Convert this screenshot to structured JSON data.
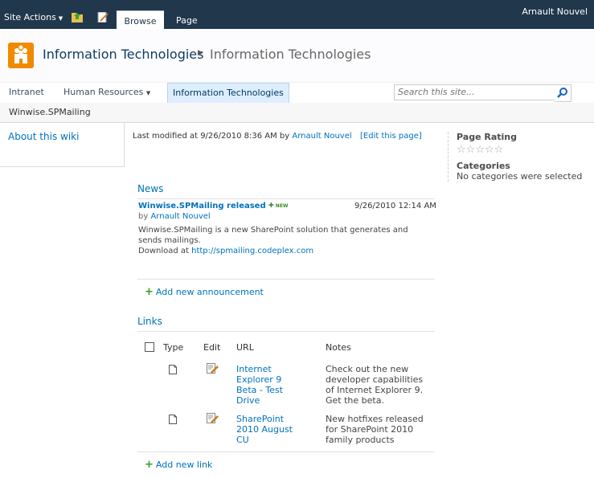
{
  "ribbon": {
    "site_actions_label": "Site Actions",
    "tabs": [
      {
        "label": "Browse",
        "selected": true
      },
      {
        "label": "Page",
        "selected": false
      }
    ],
    "user_name": "Arnault Nouvel"
  },
  "title_area": {
    "site_title": "Information Technologies",
    "page_title": "Information Technologies"
  },
  "top_nav": {
    "items": [
      {
        "label": "Intranet",
        "dropdown": false,
        "selected": false
      },
      {
        "label": "Human Resources",
        "dropdown": true,
        "selected": false
      },
      {
        "label": "Information Technologies",
        "dropdown": false,
        "selected": true
      }
    ],
    "search_placeholder": "Search this site..."
  },
  "breadcrumb": {
    "current": "Winwise.SPMailing"
  },
  "left_nav": {
    "link": "About this wiki"
  },
  "page_info": {
    "last_modified_prefix": "Last modified at 9/26/2010 8:36 AM by",
    "author": "Arnault Nouvel",
    "edit_label": "[Edit this page]"
  },
  "news": {
    "title": "News",
    "item": {
      "title": "Winwise.SPMailing released",
      "badge": "NEW",
      "date": "9/26/2010 12:14 AM",
      "by_prefix": "by",
      "author": "Arnault Nouvel",
      "body_line1": "Winwise.SPMailing is a new SharePoint solution that generates and",
      "body_line2": "sends mailings.",
      "download_prefix": "Download at",
      "download_link": "http://spmailing.codeplex.com"
    },
    "add_label": "Add new announcement"
  },
  "links": {
    "title": "Links",
    "columns": {
      "type": "Type",
      "edit": "Edit",
      "url": "URL",
      "notes": "Notes"
    },
    "rows": [
      {
        "url_lines": [
          "Internet",
          "Explorer 9",
          "Beta - Test",
          "Drive"
        ],
        "notes_lines": [
          "Check out the new",
          "developer capabilities",
          "of Internet Explorer 9.",
          "Get the beta."
        ]
      },
      {
        "url_lines": [
          "SharePoint",
          "2010 August",
          "CU"
        ],
        "notes_lines": [
          "New hotfixes released",
          "for SharePoint 2010",
          "family products"
        ]
      }
    ],
    "add_label": "Add new link"
  },
  "right_panel": {
    "rating_label": "Page Rating",
    "rating_value": 0,
    "rating_max": 5,
    "categories_label": "Categories",
    "categories_text": "No categories were selected"
  },
  "colors": {
    "ribbon": "#21374c",
    "link": "#0072bc",
    "logo": "#f08a00",
    "add_plus": "#3a9a1a"
  },
  "icons": [
    "folder-up-icon",
    "edit-page-icon",
    "site-logo-icon",
    "search-icon",
    "document-icon",
    "edit-item-icon",
    "add-icon",
    "star-icon"
  ]
}
